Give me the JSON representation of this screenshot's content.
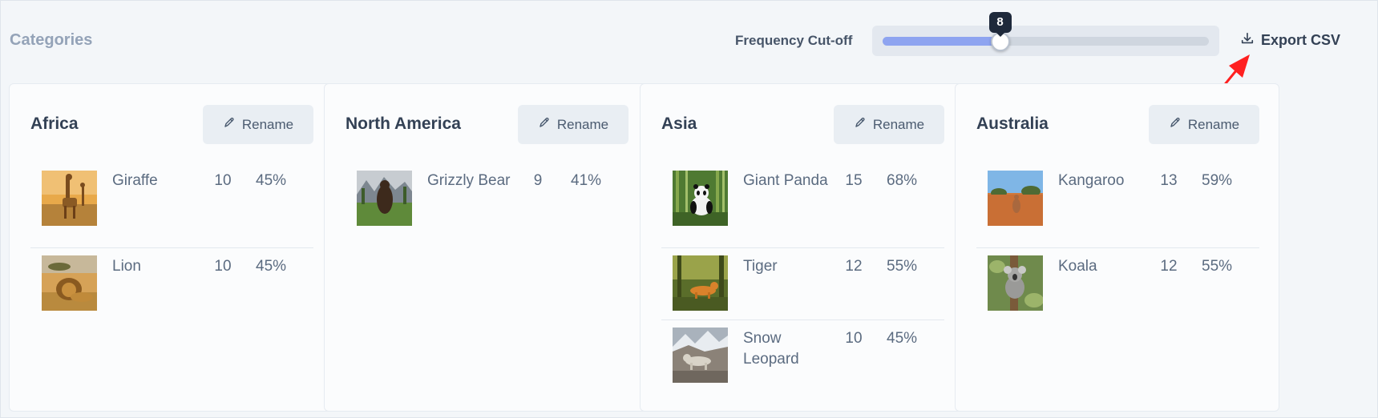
{
  "header": {
    "title": "Categories",
    "frequency_label": "Frequency Cut-off",
    "slider": {
      "value": "8",
      "fill_fraction": 0.36
    },
    "export_label": "Export CSV",
    "export_icon": "download-icon",
    "annotation_arrow_color": "#ff2020"
  },
  "colors": {
    "accent": "#8ea4f0",
    "tooltip": "#1e293b",
    "background": "#f3f6f9"
  },
  "cards": [
    {
      "title": "Africa",
      "rename_label": "Rename",
      "animals": [
        {
          "name": "Giraffe",
          "count": "10",
          "percent": "45%",
          "image": "giraffe"
        },
        {
          "name": "Lion",
          "count": "10",
          "percent": "45%",
          "image": "lion"
        }
      ]
    },
    {
      "title": "North America",
      "rename_label": "Rename",
      "animals": [
        {
          "name": "Grizzly Bear",
          "count": "9",
          "percent": "41%",
          "image": "bear"
        }
      ]
    },
    {
      "title": "Asia",
      "rename_label": "Rename",
      "animals": [
        {
          "name": "Giant Panda",
          "count": "15",
          "percent": "68%",
          "image": "panda"
        },
        {
          "name": "Tiger",
          "count": "12",
          "percent": "55%",
          "image": "tiger"
        },
        {
          "name": "Snow Leopard",
          "count": "10",
          "percent": "45%",
          "image": "leopard"
        }
      ]
    },
    {
      "title": "Australia",
      "rename_label": "Rename",
      "animals": [
        {
          "name": "Kangaroo",
          "count": "13",
          "percent": "59%",
          "image": "kangaroo"
        },
        {
          "name": "Koala",
          "count": "12",
          "percent": "55%",
          "image": "koala"
        }
      ]
    }
  ]
}
